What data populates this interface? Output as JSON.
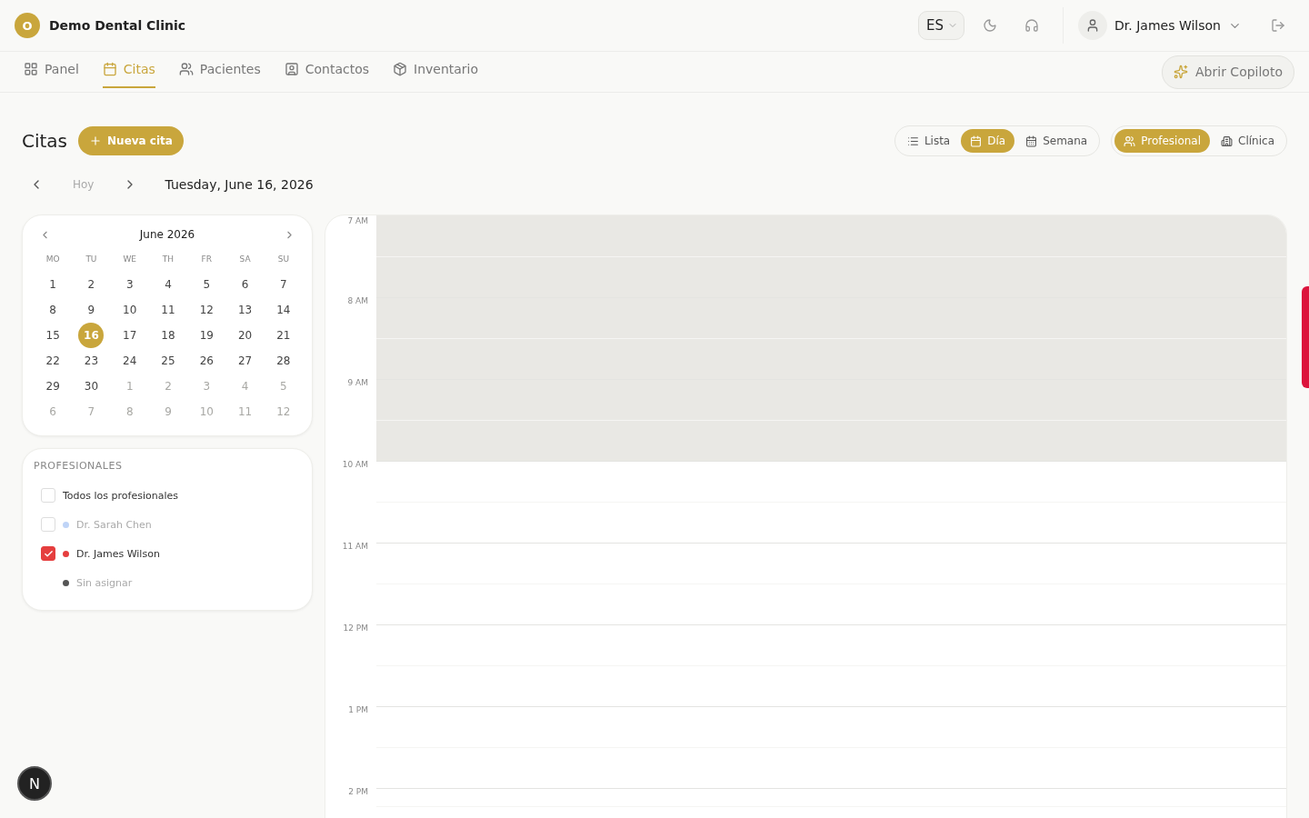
{
  "header": {
    "logo_letter": "O",
    "clinic": "Demo Dental Clinic",
    "language": "ES",
    "user": "Dr. James Wilson"
  },
  "nav": [
    {
      "label": "Panel",
      "selected": false
    },
    {
      "label": "Citas",
      "selected": true
    },
    {
      "label": "Pacientes",
      "selected": false
    },
    {
      "label": "Contactos",
      "selected": false
    },
    {
      "label": "Inventario",
      "selected": false
    }
  ],
  "copilot_button": "Abrir Copiloto",
  "page": {
    "title": "Citas",
    "new_button": "Nueva cita",
    "today": "Hoy",
    "date": "Tuesday, June 16, 2026"
  },
  "view_toggle": [
    {
      "label": "Lista",
      "selected": false
    },
    {
      "label": "Día",
      "selected": true
    },
    {
      "label": "Semana",
      "selected": false
    }
  ],
  "group_toggle": [
    {
      "label": "Profesional",
      "selected": true
    },
    {
      "label": "Clínica",
      "selected": false
    }
  ],
  "mini_calendar": {
    "month": "June 2026",
    "weekdays": [
      "MO",
      "TU",
      "WE",
      "TH",
      "FR",
      "SA",
      "SU"
    ],
    "weeks": [
      [
        {
          "day": "1",
          "muted": false,
          "selected": false
        },
        {
          "day": "2",
          "muted": false,
          "selected": false
        },
        {
          "day": "3",
          "muted": false,
          "selected": false
        },
        {
          "day": "4",
          "muted": false,
          "selected": false
        },
        {
          "day": "5",
          "muted": false,
          "selected": false
        },
        {
          "day": "6",
          "muted": false,
          "selected": false
        },
        {
          "day": "7",
          "muted": false,
          "selected": false
        }
      ],
      [
        {
          "day": "8",
          "muted": false,
          "selected": false
        },
        {
          "day": "9",
          "muted": false,
          "selected": false
        },
        {
          "day": "10",
          "muted": false,
          "selected": false
        },
        {
          "day": "11",
          "muted": false,
          "selected": false
        },
        {
          "day": "12",
          "muted": false,
          "selected": false
        },
        {
          "day": "13",
          "muted": false,
          "selected": false
        },
        {
          "day": "14",
          "muted": false,
          "selected": false
        }
      ],
      [
        {
          "day": "15",
          "muted": false,
          "selected": false
        },
        {
          "day": "16",
          "muted": false,
          "selected": true
        },
        {
          "day": "17",
          "muted": false,
          "selected": false
        },
        {
          "day": "18",
          "muted": false,
          "selected": false
        },
        {
          "day": "19",
          "muted": false,
          "selected": false
        },
        {
          "day": "20",
          "muted": false,
          "selected": false
        },
        {
          "day": "21",
          "muted": false,
          "selected": false
        }
      ],
      [
        {
          "day": "22",
          "muted": false,
          "selected": false
        },
        {
          "day": "23",
          "muted": false,
          "selected": false
        },
        {
          "day": "24",
          "muted": false,
          "selected": false
        },
        {
          "day": "25",
          "muted": false,
          "selected": false
        },
        {
          "day": "26",
          "muted": false,
          "selected": false
        },
        {
          "day": "27",
          "muted": false,
          "selected": false
        },
        {
          "day": "28",
          "muted": false,
          "selected": false
        }
      ],
      [
        {
          "day": "29",
          "muted": false,
          "selected": false
        },
        {
          "day": "30",
          "muted": false,
          "selected": false
        },
        {
          "day": "1",
          "muted": true,
          "selected": false
        },
        {
          "day": "2",
          "muted": true,
          "selected": false
        },
        {
          "day": "3",
          "muted": true,
          "selected": false
        },
        {
          "day": "4",
          "muted": true,
          "selected": false
        },
        {
          "day": "5",
          "muted": true,
          "selected": false
        }
      ],
      [
        {
          "day": "6",
          "muted": true,
          "selected": false
        },
        {
          "day": "7",
          "muted": true,
          "selected": false
        },
        {
          "day": "8",
          "muted": true,
          "selected": false
        },
        {
          "day": "9",
          "muted": true,
          "selected": false
        },
        {
          "day": "10",
          "muted": true,
          "selected": false
        },
        {
          "day": "11",
          "muted": true,
          "selected": false
        },
        {
          "day": "12",
          "muted": true,
          "selected": false
        }
      ]
    ]
  },
  "professionals": {
    "title": "PROFESIONALES",
    "items": [
      {
        "kind": "checkbox",
        "label": "Todos los profesionales",
        "checked": false,
        "dimmed": false
      },
      {
        "kind": "checkbox",
        "label": "Dr. Sarah Chen",
        "checked": false,
        "dimmed": true,
        "color": "#bfd4f7"
      },
      {
        "kind": "checkbox",
        "label": "Dr. James Wilson",
        "checked": true,
        "dimmed": false,
        "color": "#e53e3e"
      },
      {
        "kind": "plain",
        "label": "Sin asignar",
        "dimmed": true,
        "color": "#555555"
      }
    ]
  },
  "schedule": {
    "hours": [
      {
        "label": "7 AM",
        "unavailable": true
      },
      {
        "label": "8 AM",
        "unavailable": true
      },
      {
        "label": "9 AM",
        "unavailable": true
      },
      {
        "label": "10 AM",
        "unavailable": false
      },
      {
        "label": "11 AM",
        "unavailable": false
      },
      {
        "label": "12 PM",
        "unavailable": false
      },
      {
        "label": "1 PM",
        "unavailable": false
      },
      {
        "label": "2 PM",
        "unavailable": false
      }
    ]
  },
  "dev_badge": "N"
}
